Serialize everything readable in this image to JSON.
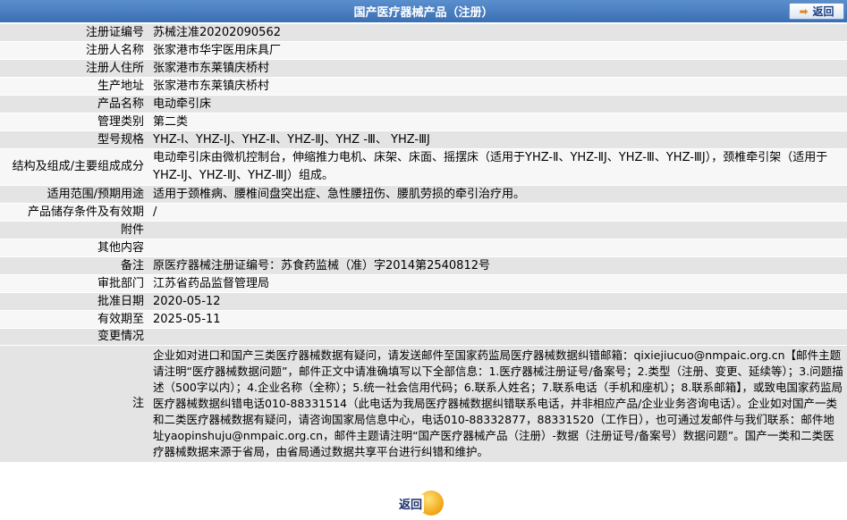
{
  "header": {
    "title": "国产医疗器械产品（注册）",
    "back_label": "返回"
  },
  "fields": [
    {
      "label": "注册证编号",
      "value": "苏械注准20202090562"
    },
    {
      "label": "注册人名称",
      "value": "张家港市华宇医用床具厂"
    },
    {
      "label": "注册人住所",
      "value": "张家港市东莱镇庆桥村"
    },
    {
      "label": "生产地址",
      "value": "张家港市东莱镇庆桥村"
    },
    {
      "label": "产品名称",
      "value": "电动牵引床"
    },
    {
      "label": "管理类别",
      "value": "第二类"
    },
    {
      "label": "型号规格",
      "value": "YHZ-Ⅰ、YHZ-ⅠJ、YHZ-Ⅱ、YHZ-ⅡJ、YHZ -Ⅲ、 YHZ-ⅢJ"
    },
    {
      "label": "结构及组成/主要组成成分",
      "value": "电动牵引床由微机控制台，伸缩推力电机、床架、床面、摇摆床（适用于YHZ-Ⅱ、YHZ-ⅡJ、YHZ-Ⅲ、YHZ-ⅢJ），颈椎牵引架（适用于YHZ-ⅠJ、YHZ-ⅡJ、YHZ-ⅢJ）组成。"
    },
    {
      "label": "适用范围/预期用途",
      "value": "适用于颈椎病、腰椎间盘突出症、急性腰扭伤、腰肌劳损的牵引治疗用。"
    },
    {
      "label": "产品储存条件及有效期",
      "value": "/"
    },
    {
      "label": "附件",
      "value": ""
    },
    {
      "label": "其他内容",
      "value": ""
    },
    {
      "label": "备注",
      "value": "原医疗器械注册证编号：苏食药监械（准）字2014第2540812号"
    },
    {
      "label": "审批部门",
      "value": "江苏省药品监督管理局"
    },
    {
      "label": "批准日期",
      "value": "2020-05-12"
    },
    {
      "label": "有效期至",
      "value": "2025-05-11"
    },
    {
      "label": "变更情况",
      "value": ""
    }
  ],
  "note": {
    "label": "注",
    "text": "企业如对进口和国产三类医疗器械数据有疑问，请发送邮件至国家药监局医疗器械数据纠错邮箱：qixiejiucuo@nmpaic.org.cn【邮件主题请注明“医疗器械数据问题”，邮件正文中请准确填写以下全部信息：1.医疗器械注册证号/备案号；2.类型（注册、变更、延续等）；3.问题描述（500字以内）；4.企业名称（全称）；5.统一社会信用代码；6.联系人姓名；7.联系电话（手机和座机）；8.联系邮箱】，或致电国家药监局医疗器械数据纠错电话010-88331514（此电话为我局医疗器械数据纠错联系电话，并非相应产品/企业业务咨询电话）。企业如对国产一类和二类医疗器械数据有疑问，请咨询国家局信息中心，电话010-88332877，88331520（工作日），也可通过发邮件与我们联系：邮件地址yaopinshuju@nmpaic.org.cn，邮件主题请注明“国产医疗器械产品（注册）-数据（注册证号/备案号）数据问题”。国产一类和二类医疗器械数据来源于省局，由省局通过数据共享平台进行纠错和维护。"
  },
  "footer": {
    "back_label": "返回"
  }
}
